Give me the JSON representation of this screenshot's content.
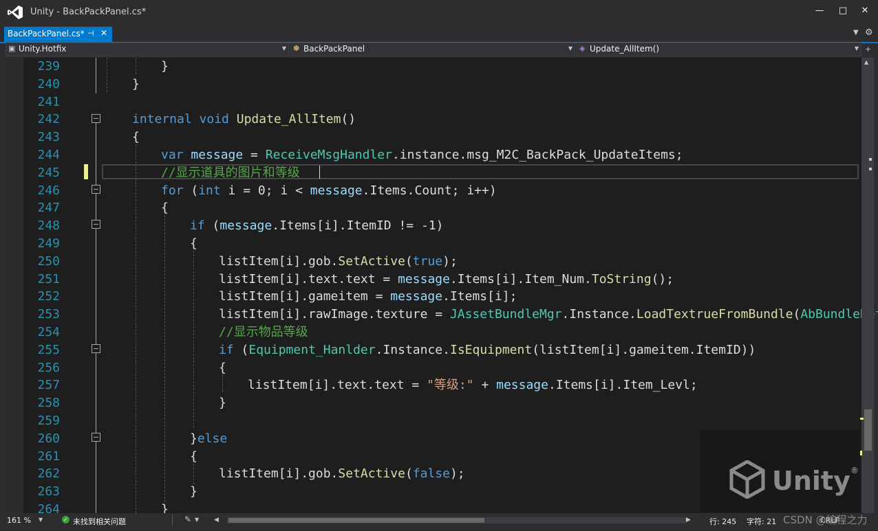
{
  "window": {
    "title": "Unity - BackPackPanel.cs*",
    "minimize_glyph": "—",
    "maximize_glyph": "□",
    "close_glyph": "✕"
  },
  "tab": {
    "label": "BackPackPanel.cs*",
    "pin_glyph": "⊣",
    "close_glyph": "✕"
  },
  "tab_overflow_glyph": "▼",
  "settings_glyph": "⚙",
  "navbar": {
    "project": "Unity.Hotfix",
    "class": "BackPackPanel",
    "member": "Update_AllItem()",
    "project_icon": "project-icon",
    "class_icon": "class-icon",
    "member_icon": "method-icon",
    "dropdown_glyph": "▼"
  },
  "line_numbers": [
    "239",
    "240",
    "241",
    "242",
    "243",
    "244",
    "245",
    "246",
    "247",
    "248",
    "249",
    "250",
    "251",
    "252",
    "253",
    "254",
    "255",
    "256",
    "257",
    "258",
    "259",
    "260",
    "261",
    "262",
    "263",
    "264"
  ],
  "code": {
    "l239": "}",
    "l240": "}",
    "l242_kw1": "internal",
    "l242_kw2": "void",
    "l242_fn": "Update_AllItem",
    "l242_rest": "()",
    "l243": "{",
    "l244_kw": "var",
    "l244_var": "message",
    "l244_eq": " = ",
    "l244_cls": "ReceiveMsgHandler",
    "l244_rest": ".instance.msg_M2C_BackPack_UpdateItems;",
    "l245_cmt": "//显示道具的图片和等级",
    "l246_kw": "for",
    "l246_p1": " (",
    "l246_kw2": "int",
    "l246_p2": " i = 0; i < ",
    "l246_var": "message",
    "l246_p3": ".Items.Count; i++)",
    "l247": "{",
    "l248_kw": "if",
    "l248_p1": " (",
    "l248_var": "message",
    "l248_p2": ".Items[i].ItemID != -1)",
    "l249": "{",
    "l250_p1": "listItem[i].gob.",
    "l250_fn": "SetActive",
    "l250_p2": "(",
    "l250_kw": "true",
    "l250_p3": ");",
    "l251_p1": "listItem[i].text.text = ",
    "l251_var": "message",
    "l251_p2": ".Items[i].Item_Num.",
    "l251_fn": "ToString",
    "l251_p3": "();",
    "l252_p1": "listItem[i].gameitem = ",
    "l252_var": "message",
    "l252_p2": ".Items[i];",
    "l253_p1": "listItem[i].rawImage.texture = ",
    "l253_cls": "JAssetBundleMgr",
    "l253_p2": ".Instance.",
    "l253_fn": "LoadTextrueFromBundle",
    "l253_p3": "(",
    "l253_cls2": "AbBundleDef",
    "l254_cmt": "//显示物品等级",
    "l255_kw": "if",
    "l255_p1": " (",
    "l255_cls": "Equipment_Hanlder",
    "l255_p2": ".Instance.",
    "l255_fn": "IsEquipment",
    "l255_p3": "(listItem[i].gameitem.ItemID))",
    "l256": "{",
    "l257_p1": "listItem[i].text.text = ",
    "l257_str": "\"等级:\"",
    "l257_p2": " + ",
    "l257_var": "message",
    "l257_p3": ".Items[i].Item_Levl;",
    "l258": "}",
    "l260_p1": "}",
    "l260_kw": "else",
    "l261": "{",
    "l262_p1": "listItem[i].gob.",
    "l262_fn": "SetActive",
    "l262_p2": "(",
    "l262_kw": "false",
    "l262_p3": ");",
    "l263": "}",
    "l264": "}"
  },
  "colors": {
    "keyword": "#569cd6",
    "type": "#4ec9b0",
    "method": "#dcdcaa",
    "variable": "#9cdcfe",
    "comment": "#57a64a",
    "string": "#d69d85",
    "accent": "#007acc"
  },
  "status": {
    "zoom": "161 %",
    "issues": "未找到相关问题",
    "line": "行: 245",
    "char": "字符: 21",
    "enc": "CRLF",
    "issues_icon": "check-circle-icon",
    "brush_icon": "brush-icon"
  },
  "watermark": {
    "brand": "Unity",
    "registered": "®",
    "site": "CSDN @编程之力"
  }
}
